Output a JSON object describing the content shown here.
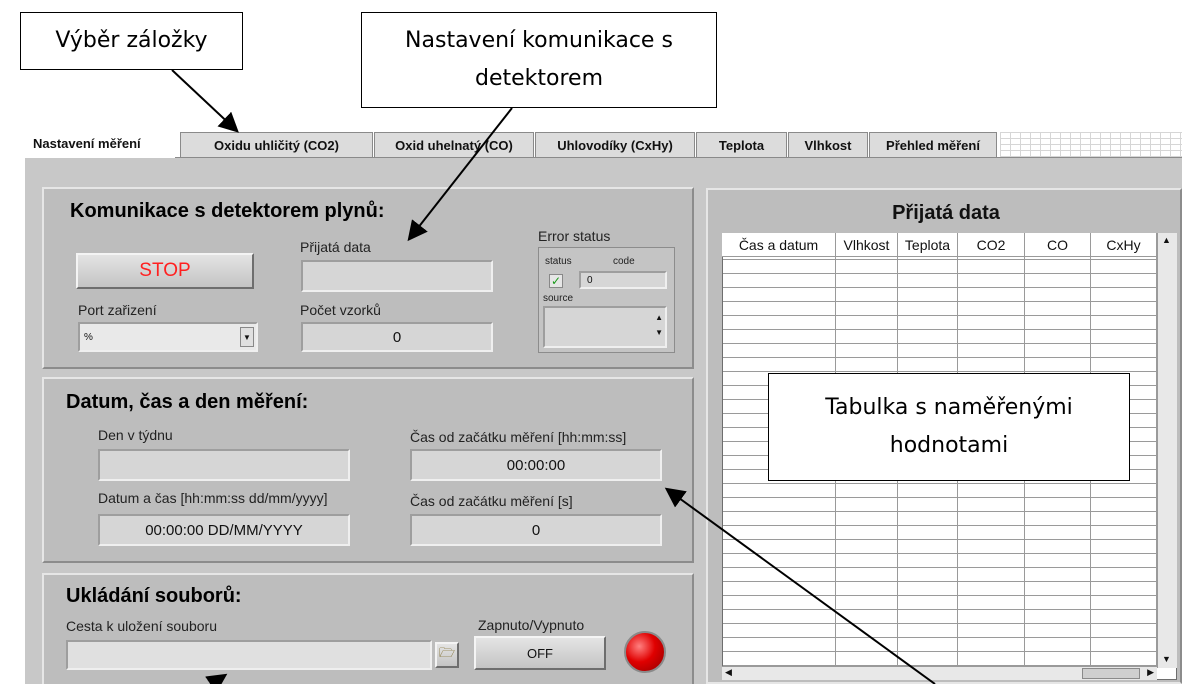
{
  "callouts": {
    "tab_select": "Výběr záložky",
    "comm_settings_line1": "Nastavení komunikace s",
    "comm_settings_line2": "detektorem",
    "table_note_line1": "Tabulka s naměřenými",
    "table_note_line2": "hodnotami"
  },
  "tabs": [
    {
      "label": "Nastavení měření"
    },
    {
      "label": "Oxidu uhličitý (CO2)"
    },
    {
      "label": "Oxid uhelnatý (CO)"
    },
    {
      "label": "Uhlovodíky (CxHy)"
    },
    {
      "label": "Teplota"
    },
    {
      "label": "Vlhkost"
    },
    {
      "label": "Přehled měření"
    }
  ],
  "comm": {
    "title": "Komunikace s detektorem plynů:",
    "stop_label": "STOP",
    "port_label": "Port zařizení",
    "port_value": "%",
    "received_label": "Přijatá data",
    "received_value": "",
    "samples_label": "Počet vzorků",
    "samples_value": "0",
    "error": {
      "title": "Error status",
      "status_label": "status",
      "code_label": "code",
      "code_value": "0",
      "source_label": "source",
      "status_check": "✓"
    }
  },
  "datetime": {
    "title": "Datum, čas a den měření:",
    "weekday_label": "Den v týdnu",
    "weekday_value": "",
    "datetime_label": "Datum a čas [hh:mm:ss dd/mm/yyyy]",
    "datetime_value": "00:00:00 DD/MM/YYYY",
    "elapsed_hms_label": "Čas od začátku měření [hh:mm:ss]",
    "elapsed_hms_value": "00:00:00",
    "elapsed_s_label": "Čas od začátku měření [s]",
    "elapsed_s_value": "0"
  },
  "files": {
    "title": "Ukládání souborů:",
    "path_label": "Cesta k uložení souboru",
    "path_value": "",
    "toggle_label": "Zapnuto/Vypnuto",
    "toggle_value": "OFF",
    "led_color": "#e00000"
  },
  "table": {
    "title": "Přijatá data",
    "columns": [
      "Čas a datum",
      "Vlhkost",
      "Teplota",
      "CO2",
      "CO",
      "CxHy"
    ]
  },
  "colors": {
    "panel": "#bdbdbd",
    "stop_text": "#ff2020",
    "arrow": "#000000"
  }
}
